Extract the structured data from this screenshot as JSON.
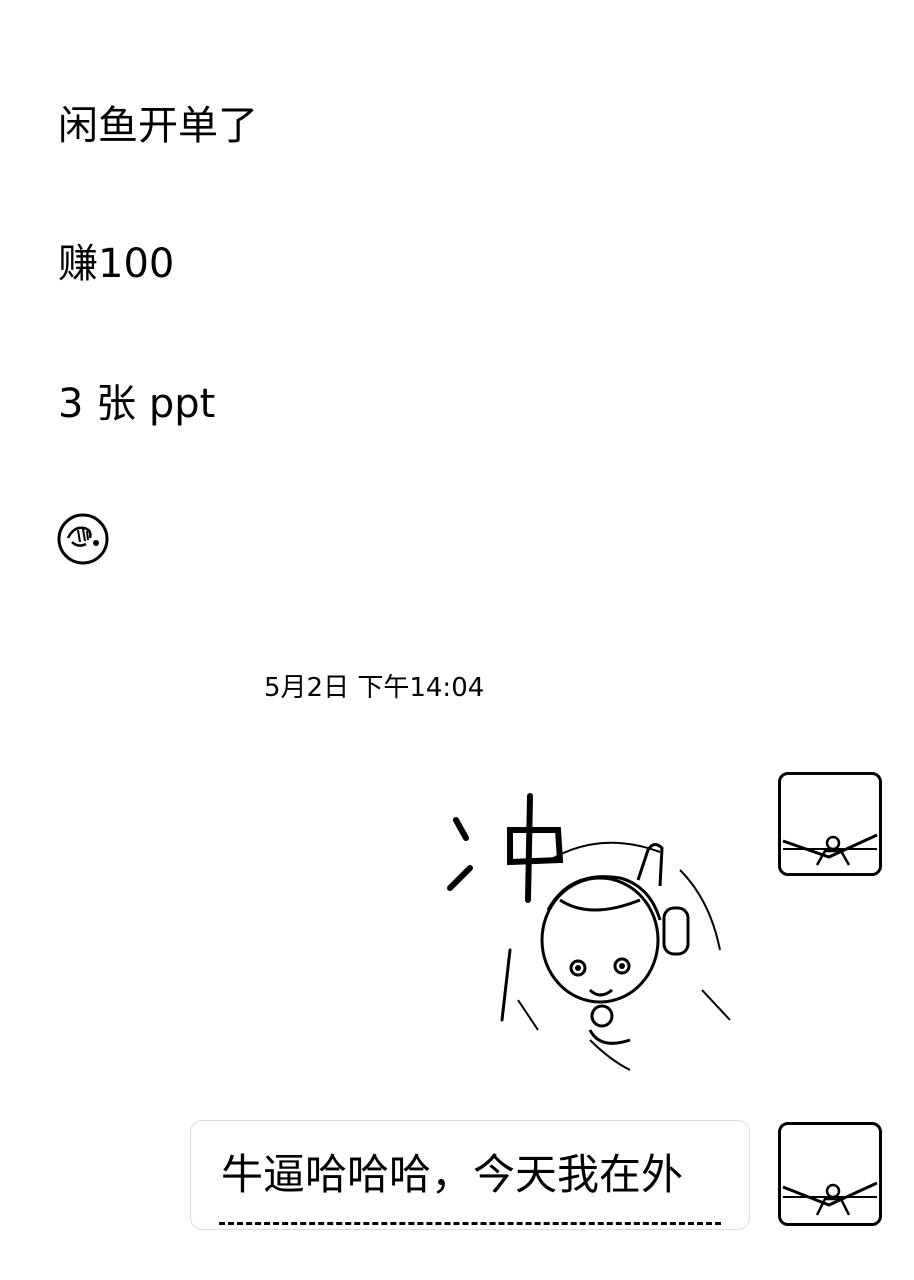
{
  "messages": [
    {
      "text": "闲鱼开单了"
    },
    {
      "text": "赚100"
    },
    {
      "text": "3 张 ppt"
    }
  ],
  "emoji": {
    "icon": "facepalm-emoji-icon"
  },
  "timestamp": "5月2日 下午14:04",
  "sticker": {
    "icon": "cheering-anime-girl-sticker",
    "caption_icon": "chong-calligraphy"
  },
  "outgoing_message": {
    "text": "牛逼哈哈哈，今天我在外"
  },
  "avatar": {
    "icon": "avatar-icon"
  }
}
